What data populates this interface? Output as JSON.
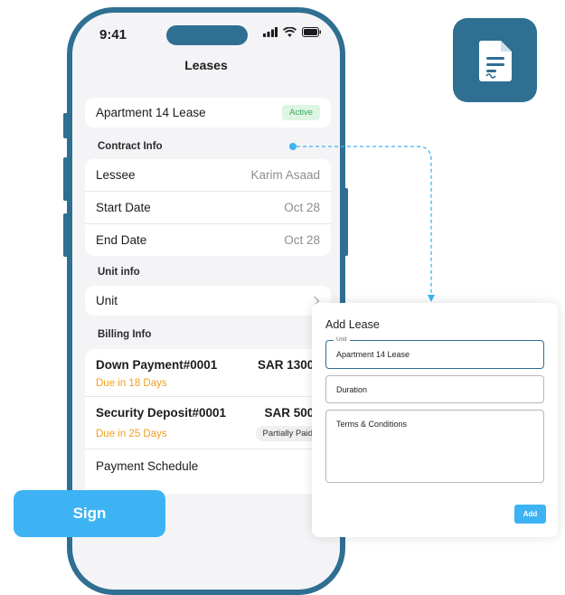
{
  "status_bar": {
    "time": "9:41"
  },
  "nav": {
    "title": "Leases"
  },
  "lease_header": {
    "name": "Apartment 14 Lease",
    "status": "Active"
  },
  "contract": {
    "title": "Contract Info",
    "rows": [
      {
        "label": "Lessee",
        "value": "Karim Asaad"
      },
      {
        "label": "Start Date",
        "value": "Oct 28"
      },
      {
        "label": "End Date",
        "value": "Oct 28"
      }
    ]
  },
  "unit": {
    "title": "Unit info",
    "row_label": "Unit"
  },
  "billing": {
    "title": "Billing Info",
    "items": [
      {
        "name": "Down Payment#0001",
        "amount": "SAR 1300.00",
        "due": "Due in 18 Days",
        "status": ""
      },
      {
        "name": "Security Deposit#0001",
        "amount": "SAR 500.00",
        "due": "Due in 25 Days",
        "status": "Partially Paid"
      }
    ],
    "schedule_label": "Payment Schedule"
  },
  "sign_button": {
    "label": "Sign"
  },
  "doc_icon": {
    "name": "document-icon",
    "color": "#2f6f92"
  },
  "form": {
    "title": "Add Lease",
    "unit_legend": "Unit",
    "unit_value": "Apartment 14 Lease",
    "duration_placeholder": "Duration",
    "terms_placeholder": "Terms & Conditions",
    "add_label": "Add"
  },
  "colors": {
    "accent": "#2f6f92",
    "button": "#3db3f3",
    "due": "#f0a020",
    "active_bg": "#dff5e3",
    "active_text": "#3aa757"
  }
}
